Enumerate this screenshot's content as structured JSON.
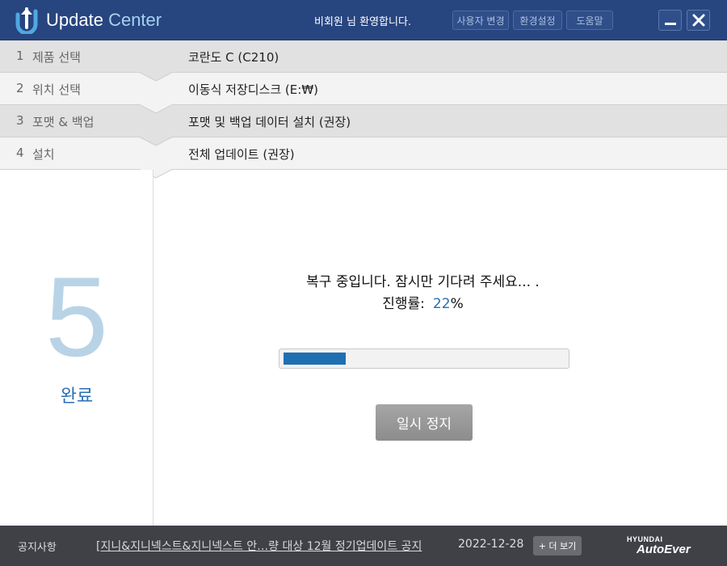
{
  "header": {
    "app_name": "Update",
    "app_name_accent": "Center",
    "welcome": "비회원  님 환영합니다.",
    "buttons": [
      "사용자 변경",
      "환경설정",
      "도움말"
    ],
    "logo_icon": "update-logo-icon",
    "minimize_icon": "minimize-icon",
    "close_icon": "close-icon"
  },
  "steps": [
    {
      "num": "1",
      "name": "제품 선택",
      "value": "코란도 C (C210)"
    },
    {
      "num": "2",
      "name": "위치 선택",
      "value": "이동식 저장디스크 (E:₩)"
    },
    {
      "num": "3",
      "name": "포맷 & 백업",
      "value": "포맷 및 백업 데이터 설치 (권장)"
    },
    {
      "num": "4",
      "name": "설치",
      "value": "전체 업데이트 (권장)"
    }
  ],
  "current_step": {
    "num": "5",
    "label": "완료"
  },
  "main": {
    "status": "복구 중입니다. 잠시만 기다려 주세요... .",
    "progress_label": "진행률:",
    "progress_value": "22",
    "progress_unit": "%",
    "progress_fraction": 0.22,
    "pause_button": "일시 정지"
  },
  "footer": {
    "notice_label": "공지사항",
    "notice_link": "[지니&지니넥스트&지니넥스트  안…량 대상 12월 정기업데이트 공지",
    "notice_date": "2022-12-28",
    "more_button": "+ 더 보기",
    "brand_top": "HYUNDAI",
    "brand_bottom": "AutoEver"
  },
  "colors": {
    "header_bg": "#27457f",
    "accent": "#a8d1f0",
    "progress": "#1f6fb3",
    "step_big_number": "#b9d3e6",
    "done_label": "#2a6eb5",
    "footer_bg": "#3f4147"
  }
}
